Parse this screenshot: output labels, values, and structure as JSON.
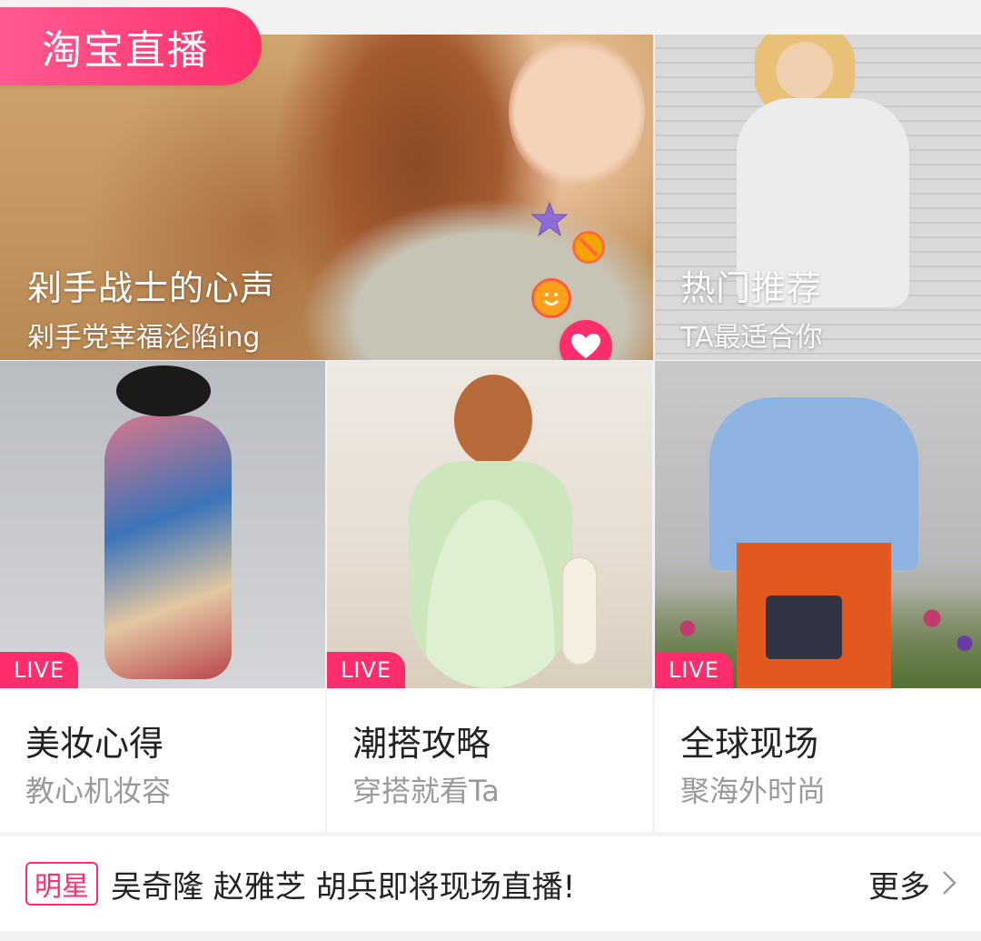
{
  "header": {
    "brand_label": "淘宝直播"
  },
  "hero": {
    "main": {
      "title": "剁手战士的心声",
      "subtitle": "剁手党幸福沦陷ing"
    },
    "side": {
      "title": "热门推荐",
      "subtitle": "TA最适合你"
    },
    "reactions": [
      "star-icon",
      "ban-icon",
      "smile-icon",
      "heart-icon"
    ]
  },
  "cards": [
    {
      "badge": "LIVE",
      "title": "美妆心得",
      "subtitle": "教心机妆容"
    },
    {
      "badge": "LIVE",
      "title": "潮搭攻略",
      "subtitle": "穿搭就看Ta"
    },
    {
      "badge": "LIVE",
      "title": "全球现场",
      "subtitle": "聚海外时尚"
    }
  ],
  "ticker": {
    "tag": "明星",
    "text": "吴奇隆 赵雅芝 胡兵即将现场直播!",
    "more": "更多"
  },
  "colors": {
    "accent": "#ff2d6c",
    "text": "#222222",
    "muted": "#9a9a9a",
    "bg": "#f2f2f2"
  }
}
